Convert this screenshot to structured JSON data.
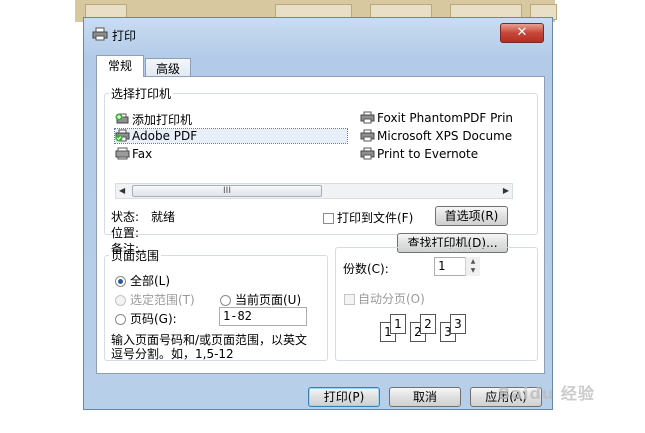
{
  "dialog": {
    "title": "打印",
    "close_label": "✕"
  },
  "tabs": [
    {
      "label": "常规"
    },
    {
      "label": "高级"
    }
  ],
  "select_printer": {
    "legend": "选择打印机",
    "printers": [
      {
        "name": "添加打印机",
        "icon": "add-printer-icon"
      },
      {
        "name": "Foxit PhantomPDF Prin",
        "icon": "printer-icon"
      },
      {
        "name": "Adobe PDF",
        "icon": "printer-check-icon",
        "selected": true
      },
      {
        "name": "Microsoft XPS Docume",
        "icon": "printer-icon"
      },
      {
        "name": "Fax",
        "icon": "fax-icon"
      },
      {
        "name": "Print to Evernote",
        "icon": "printer-icon"
      }
    ],
    "scroll_left": "◀",
    "scroll_right": "▶",
    "scroll_thumb": "III",
    "status_label": "状态:",
    "status_value": "就绪",
    "location_label": "位置:",
    "comment_label": "备注:",
    "print_to_file_label": "打印到文件(F)",
    "preferences_button": "首选项(R)",
    "find_printer_button": "查找打印机(D)..."
  },
  "page_range": {
    "legend": "页面范围",
    "all_label": "全部(L)",
    "selection_label": "选定范围(T)",
    "current_page_label": "当前页面(U)",
    "pages_label": "页码(G):",
    "pages_value": "1-82",
    "hint_line1": "输入页面号码和/或页面范围，以英文",
    "hint_line2": "逗号分割。如，1,5-12"
  },
  "copies": {
    "label": "份数(C):",
    "value": "1",
    "collate_label": "自动分页(O)",
    "collate_sheets": [
      "1",
      "1",
      "2",
      "2",
      "3",
      "3"
    ]
  },
  "footer": {
    "print_button": "打印(P)",
    "cancel_button": "取消",
    "apply_button": "应用(A)"
  },
  "watermark": "Baidu 经验",
  "colors": {
    "window_frame": "#b8cfe9",
    "close_button": "#c7463a",
    "accent": "#3c7fb1"
  }
}
